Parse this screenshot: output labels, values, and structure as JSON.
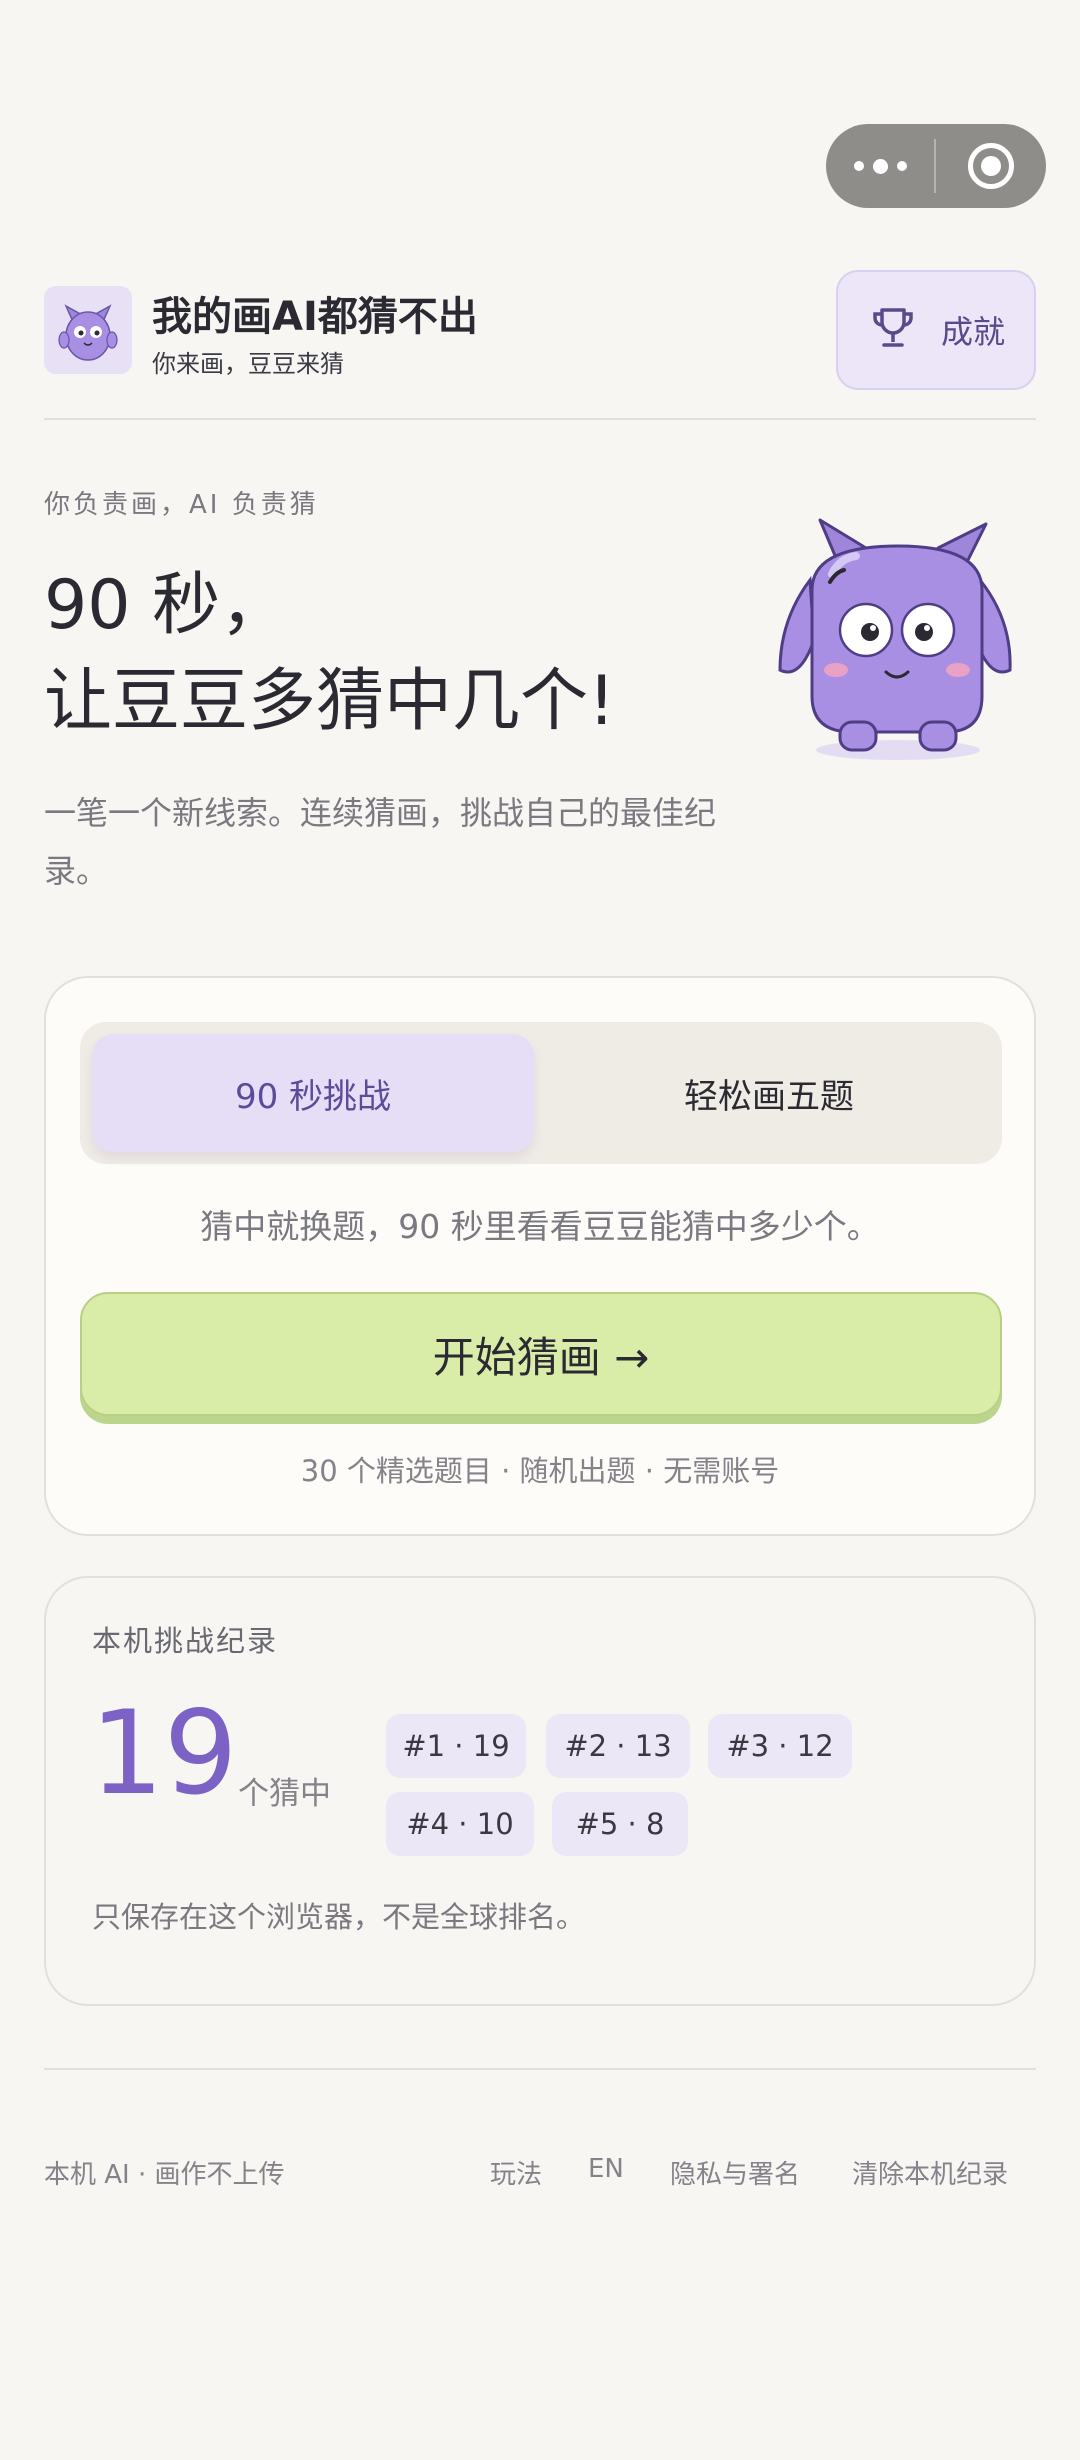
{
  "app": {
    "title": "我的画AI都猜不出",
    "subtitle": "你来画，豆豆来猜",
    "achievements_label": "成就"
  },
  "hero": {
    "eyebrow": "你负责画，AI 负责猜",
    "title_line1": "90 秒，",
    "title_line2": "让豆豆多猜中几个!",
    "description": "一笔一个新线索。连续猜画，挑战自己的最佳纪录。"
  },
  "modes": {
    "tabs": [
      {
        "label": "90 秒挑战",
        "active": true
      },
      {
        "label": "轻松画五题",
        "active": false
      }
    ],
    "description": "猜中就换题，90 秒里看看豆豆能猜中多少个。",
    "start_label": "开始猜画 →",
    "footnote": "30 个精选题目 · 随机出题 · 无需账号"
  },
  "record": {
    "title": "本机挑战纪录",
    "best": "19",
    "best_unit": "个猜中",
    "ranks": [
      "#1 · 19",
      "#2 · 13",
      "#3 · 12",
      "#4 · 10",
      "#5 · 8"
    ],
    "note": "只保存在这个浏览器，不是全球排名。"
  },
  "footer": {
    "left": "本机 AI · 画作不上传",
    "links": [
      "玩法",
      "EN",
      "隐私与署名",
      "清除本机纪录"
    ]
  },
  "colors": {
    "background": "#f7f6f3",
    "accent_purple": "#7b62c4",
    "start_green": "#d9eca8",
    "mascot_purple": "#a88fe3"
  },
  "icons": {
    "capsule": [
      "more-dots-icon",
      "close-target-icon"
    ],
    "achievements": "trophy-icon",
    "logo": "mascot-logo-icon"
  }
}
